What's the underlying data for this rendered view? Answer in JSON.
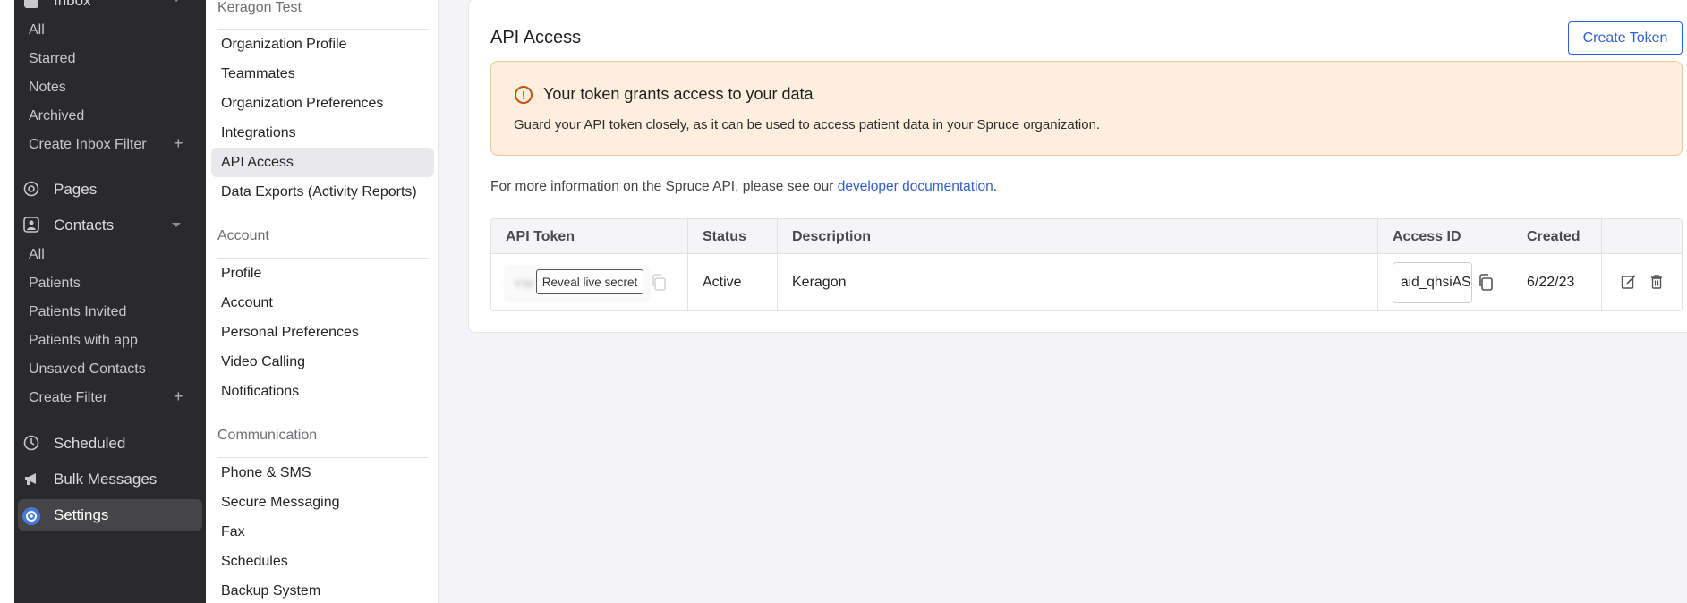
{
  "nav": {
    "inbox_label": "Inbox",
    "inbox_items": [
      "All",
      "Starred",
      "Notes",
      "Archived"
    ],
    "create_inbox_filter": "Create Inbox Filter",
    "pages": "Pages",
    "contacts": "Contacts",
    "contacts_items": [
      "All",
      "Patients",
      "Patients Invited",
      "Patients with app",
      "Unsaved Contacts"
    ],
    "create_filter": "Create Filter",
    "scheduled": "Scheduled",
    "bulk_messages": "Bulk Messages",
    "settings": "Settings"
  },
  "settings_menu": {
    "org_name": "Keragon Test",
    "org_items": [
      "Organization Profile",
      "Teammates",
      "Organization Preferences",
      "Integrations",
      "API Access",
      "Data Exports (Activity Reports)"
    ],
    "account_heading": "Account",
    "account_items": [
      "Profile",
      "Account",
      "Personal Preferences",
      "Video Calling",
      "Notifications"
    ],
    "communication_heading": "Communication",
    "communication_items": [
      "Phone & SMS",
      "Secure Messaging",
      "Fax",
      "Schedules",
      "Backup System"
    ],
    "active_item": "API Access"
  },
  "main": {
    "title": "API Access",
    "create_button": "Create Token",
    "warning": {
      "title": "Your token grants access to your data",
      "text": "Guard your API token closely, as it can be used to access patient data in your Spruce organization."
    },
    "info_text": "For more information on the Spruce API, please see our ",
    "info_link": "developer documentation",
    "info_suffix": ".",
    "table": {
      "headers": [
        "API Token",
        "Status",
        "Description",
        "Access ID",
        "Created"
      ],
      "rows": [
        {
          "token_mask": "YW",
          "reveal_label": "Reveal live secret",
          "status": "Active",
          "description": "Keragon",
          "access_id": "aid_qhsiAS",
          "created": "6/22/23"
        }
      ]
    }
  },
  "colors": {
    "accent": "#2f5fcf",
    "warning_bg": "#fdeedd",
    "warning_icon": "#c6520d",
    "nav_bg": "#2a2a2c"
  }
}
